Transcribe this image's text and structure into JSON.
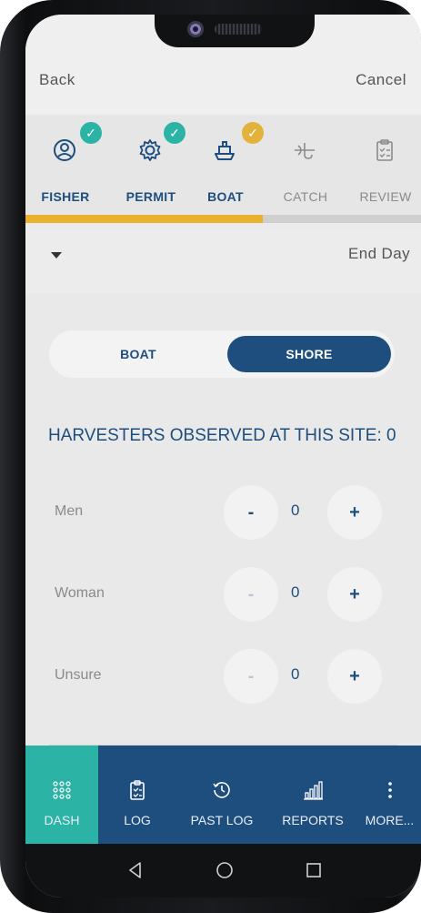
{
  "topbar": {
    "back_label": "Back",
    "cancel_label": "Cancel"
  },
  "steps": [
    {
      "label": "FISHER",
      "icon": "user-circle-icon",
      "status": "done"
    },
    {
      "label": "PERMIT",
      "icon": "gear-icon",
      "status": "done"
    },
    {
      "label": "BOAT",
      "icon": "boat-icon",
      "status": "current"
    },
    {
      "label": "CATCH",
      "icon": "fish-hook-icon",
      "status": "todo"
    },
    {
      "label": "REVIEW",
      "icon": "clipboard-icon",
      "status": "todo"
    }
  ],
  "progress": {
    "fraction": 0.6
  },
  "day": {
    "end_day_label": "End Day"
  },
  "mode_toggle": {
    "boat_label": "BOAT",
    "shore_label": "SHORE",
    "selected": "SHORE"
  },
  "harvesters": {
    "heading": "HARVESTERS OBSERVED AT THIS SITE: 0",
    "counters": [
      {
        "label": "Men",
        "value": "0"
      },
      {
        "label": "Woman",
        "value": "0"
      },
      {
        "label": "Unsure",
        "value": "0"
      }
    ],
    "minus_label": "-",
    "plus_label": "+"
  },
  "bottom_nav": [
    {
      "label": "DASH",
      "icon": "grid-dots-icon",
      "active": true
    },
    {
      "label": "LOG",
      "icon": "clipboard-check-icon",
      "active": false
    },
    {
      "label": "PAST LOG",
      "icon": "history-icon",
      "active": false
    },
    {
      "label": "REPORTS",
      "icon": "bar-chart-icon",
      "active": false
    },
    {
      "label": "MORE...",
      "icon": "more-vertical-icon",
      "active": false
    }
  ],
  "colors": {
    "primary": "#1d4e7e",
    "teal": "#2bb3a6",
    "gold": "#e3b23c"
  }
}
